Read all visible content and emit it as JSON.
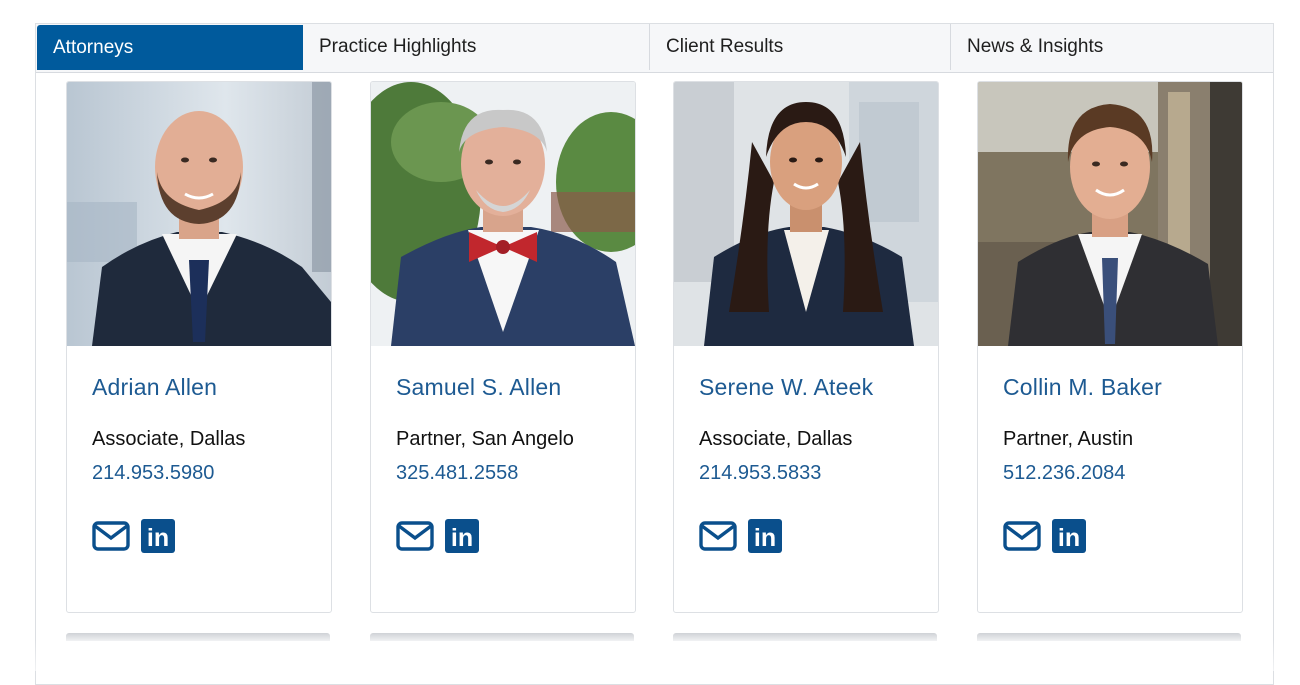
{
  "tabs": [
    {
      "label": "Attorneys",
      "active": true
    },
    {
      "label": "Practice Highlights",
      "active": false
    },
    {
      "label": "Client Results",
      "active": false
    },
    {
      "label": "News & Insights",
      "active": false
    }
  ],
  "attorneys": [
    {
      "name": "Adrian Allen",
      "role": "Associate, Dallas",
      "phone": "214.953.5980"
    },
    {
      "name": "Samuel S. Allen",
      "role": "Partner, San Angelo",
      "phone": "325.481.2558"
    },
    {
      "name": "Serene W. Ateek",
      "role": "Associate, Dallas",
      "phone": "214.953.5833"
    },
    {
      "name": "Collin M. Baker",
      "role": "Partner, Austin",
      "phone": "512.236.2084"
    }
  ],
  "icons": {
    "email": "envelope-icon",
    "linkedin": "linkedin-icon",
    "linkedin_text": "in"
  },
  "colors": {
    "brand_blue": "#005a9c",
    "link_blue": "#1d5a92",
    "icon_blue": "#0a4f8c"
  }
}
